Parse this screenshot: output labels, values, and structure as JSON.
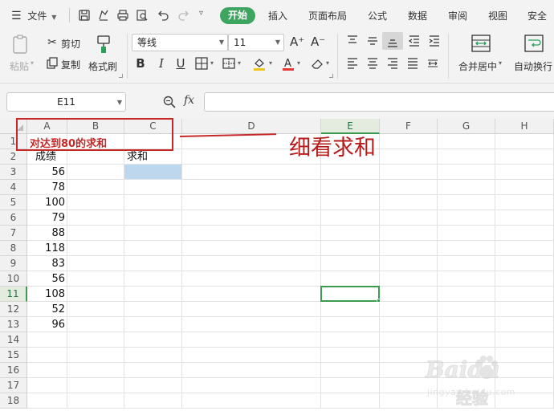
{
  "menu": {
    "file_label": "文件",
    "tabs": [
      "开始",
      "插入",
      "页面布局",
      "公式",
      "数据",
      "审阅",
      "视图",
      "安全"
    ]
  },
  "ribbon": {
    "paste_label": "粘贴",
    "cut_label": "剪切",
    "copy_label": "复制",
    "format_painter_label": "格式刷",
    "font_name": "等线",
    "font_size": "11",
    "increase_font": "A⁺",
    "decrease_font": "A⁻",
    "merge_center_label": "合并居中",
    "wrap_text_label": "自动换行"
  },
  "formula_bar": {
    "name_box": "E11",
    "fx_label": "fx",
    "formula": ""
  },
  "grid": {
    "columns": [
      "A",
      "B",
      "C",
      "D",
      "E",
      "F",
      "G",
      "H"
    ],
    "rows": [
      "1",
      "2",
      "3",
      "4",
      "5",
      "6",
      "7",
      "8",
      "9",
      "10",
      "11",
      "12",
      "13",
      "14",
      "15",
      "16",
      "17",
      "18"
    ],
    "active_column": "E",
    "active_row": "11",
    "a1_text": "对达到80的求和",
    "a2_header": "成绩",
    "c2_header": "求和",
    "scores": [
      56,
      78,
      100,
      79,
      88,
      118,
      83,
      56,
      108,
      52,
      96
    ]
  },
  "annotation": {
    "note": "细看求和",
    "color": "#c62828"
  },
  "watermark": {
    "logo_text": "Baidu",
    "logo_suffix": "经验",
    "site": "jingyan.baidu.com"
  },
  "colors": {
    "accent": "#3da55f",
    "selection": "#3a9a4e",
    "fill_c3": "#bdd7ee"
  }
}
